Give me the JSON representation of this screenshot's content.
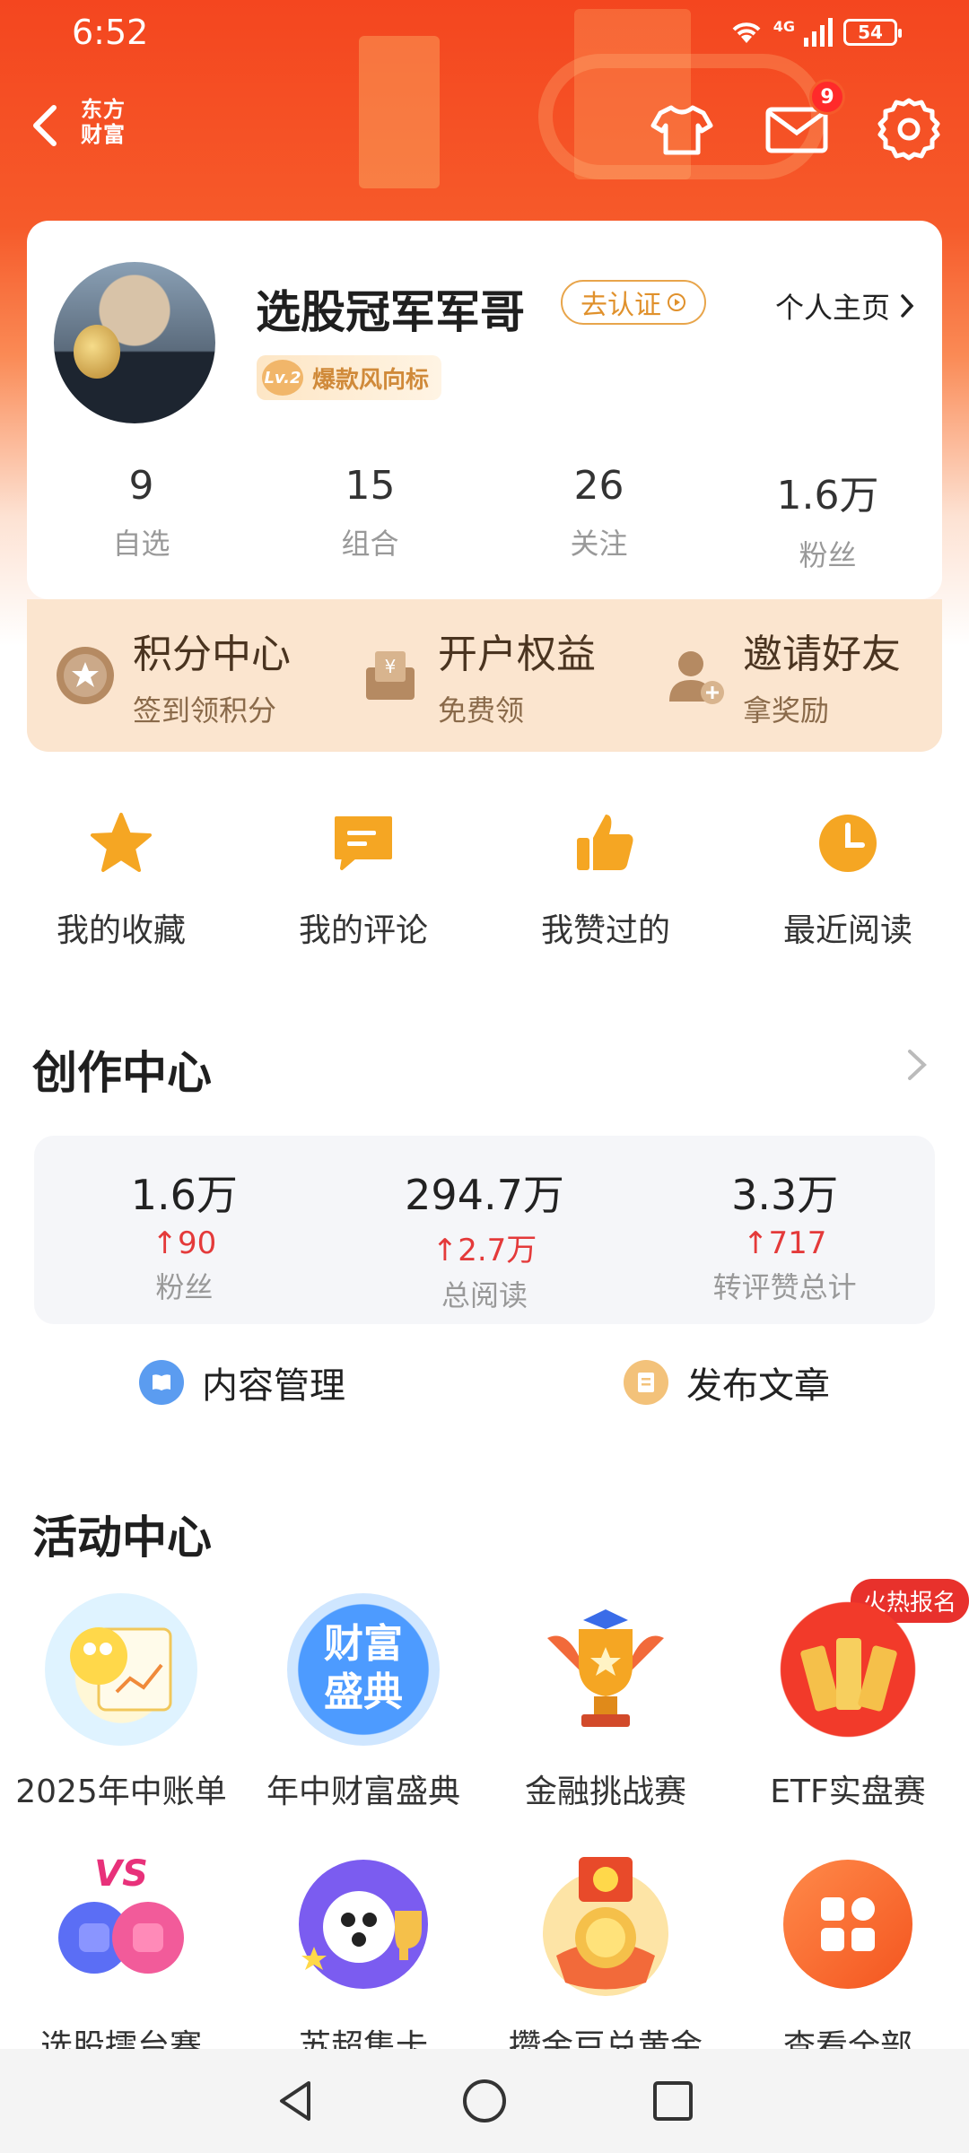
{
  "status_bar": {
    "time": "6:52",
    "network": "4G",
    "battery": "54"
  },
  "header": {
    "brand_line1": "东方",
    "brand_line2": "财富",
    "mail_badge": "9",
    "icons": [
      "back-icon",
      "shirt-icon",
      "mail-icon",
      "gear-icon"
    ]
  },
  "profile": {
    "username": "选股冠军军哥",
    "verify_label": "去认证",
    "homepage_label": "个人主页",
    "level": "Lv.2",
    "level_title": "爆款风向标",
    "stats": [
      {
        "value": "9",
        "label": "自选"
      },
      {
        "value": "15",
        "label": "组合"
      },
      {
        "value": "26",
        "label": "关注"
      },
      {
        "value": "1.6万",
        "label": "粉丝"
      }
    ]
  },
  "perks": [
    {
      "title": "积分中心",
      "sub": "签到领积分",
      "icon": "points-icon"
    },
    {
      "title": "开户权益",
      "sub": "免费领",
      "icon": "account-icon"
    },
    {
      "title": "邀请好友",
      "sub": "拿奖励",
      "icon": "invite-icon"
    }
  ],
  "quick_links": [
    {
      "label": "我的收藏",
      "icon": "star-icon"
    },
    {
      "label": "我的评论",
      "icon": "comment-icon"
    },
    {
      "label": "我赞过的",
      "icon": "thumbs-up-icon"
    },
    {
      "label": "最近阅读",
      "icon": "clock-icon"
    }
  ],
  "creation_center": {
    "title": "创作中心",
    "stats": [
      {
        "value": "1.6万",
        "delta": "90",
        "label": "粉丝"
      },
      {
        "value": "294.7万",
        "delta": "2.7万",
        "label": "总阅读"
      },
      {
        "value": "3.3万",
        "delta": "717",
        "label": "转评赞总计"
      }
    ],
    "actions": [
      {
        "label": "内容管理",
        "icon": "content-manage-icon"
      },
      {
        "label": "发布文章",
        "icon": "publish-article-icon"
      }
    ]
  },
  "activity_center": {
    "title": "活动中心",
    "hot_tag": "火热报名",
    "row1": [
      {
        "label": "2025年中账单"
      },
      {
        "label": "年中财富盛典",
        "art_text": "财富盛典"
      },
      {
        "label": "金融挑战赛"
      },
      {
        "label": "ETF实盘赛"
      }
    ],
    "row2": [
      {
        "label": "选股擂台赛",
        "art_text": "VS"
      },
      {
        "label": "苏超集卡"
      },
      {
        "label": "攒金豆兑黄金"
      },
      {
        "label": "查看全部"
      }
    ]
  },
  "colors": {
    "brand_orange": "#f4461f",
    "accent_gold": "#f5a623",
    "up_red": "#e43a3a",
    "perk_bg": "#fbe5cf"
  }
}
